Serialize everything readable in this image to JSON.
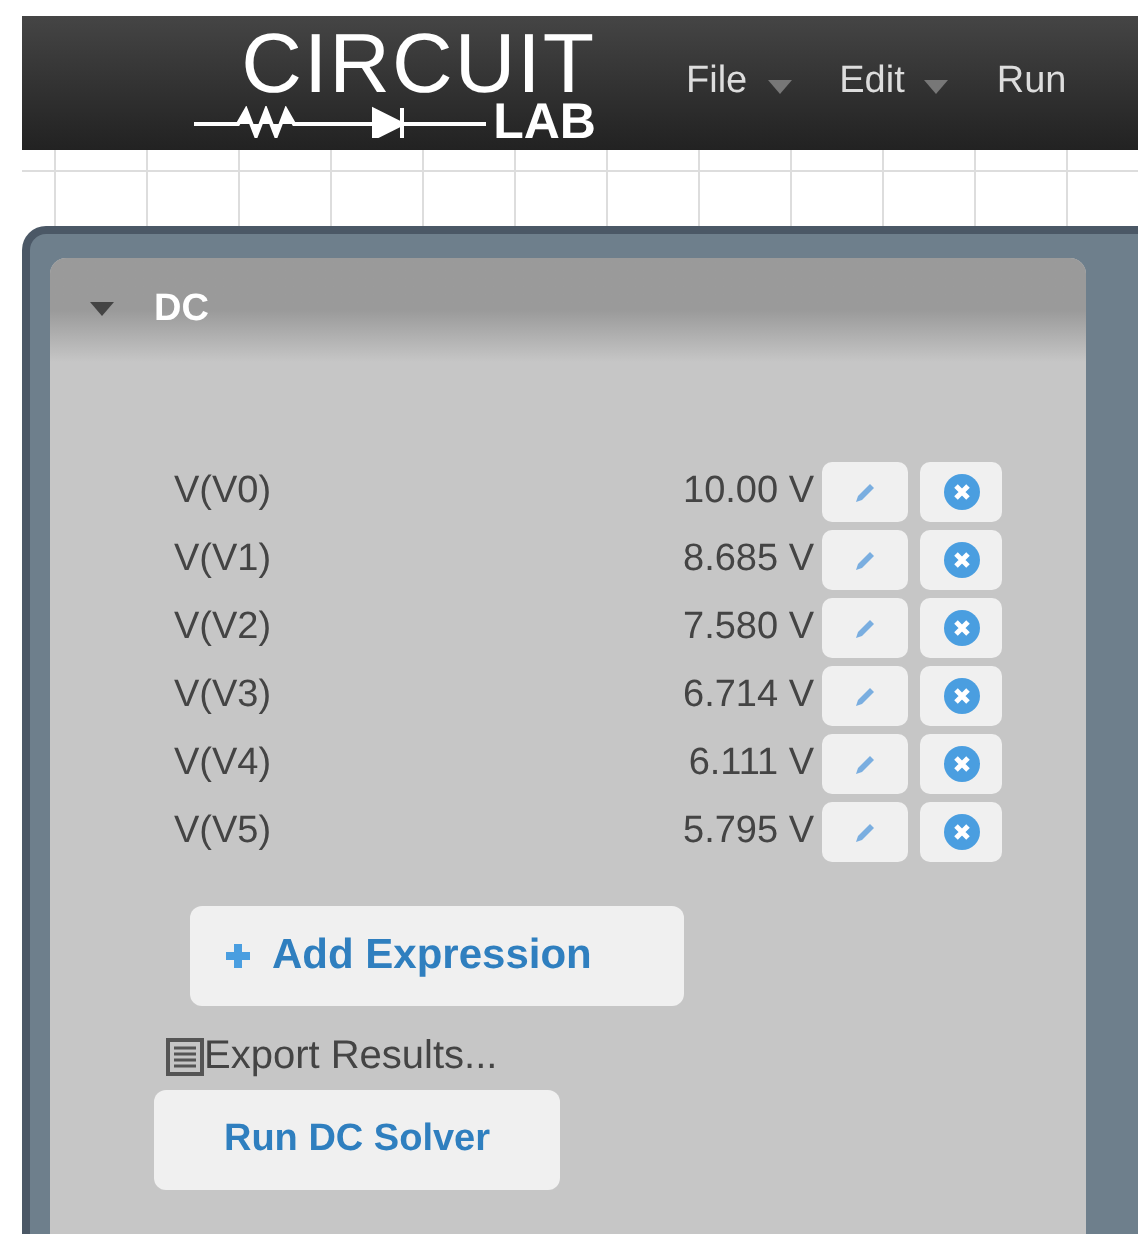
{
  "logo": {
    "top": "CIRCUIT",
    "bottom": "LAB"
  },
  "menu": [
    {
      "label": "File",
      "dropdown": true
    },
    {
      "label": "Edit",
      "dropdown": true
    },
    {
      "label": "Run",
      "dropdown": false
    }
  ],
  "panel": {
    "title": "DC",
    "expanded": true,
    "rows": [
      {
        "name": "V(V0)",
        "value": "10.00 V"
      },
      {
        "name": "V(V1)",
        "value": "8.685 V"
      },
      {
        "name": "V(V2)",
        "value": "7.580 V"
      },
      {
        "name": "V(V3)",
        "value": "6.714 V"
      },
      {
        "name": "V(V4)",
        "value": "6.111 V"
      },
      {
        "name": "V(V5)",
        "value": "5.795 V"
      }
    ],
    "add_button": "Add Expression",
    "export_link": "Export Results...",
    "run_button": "Run DC Solver"
  }
}
